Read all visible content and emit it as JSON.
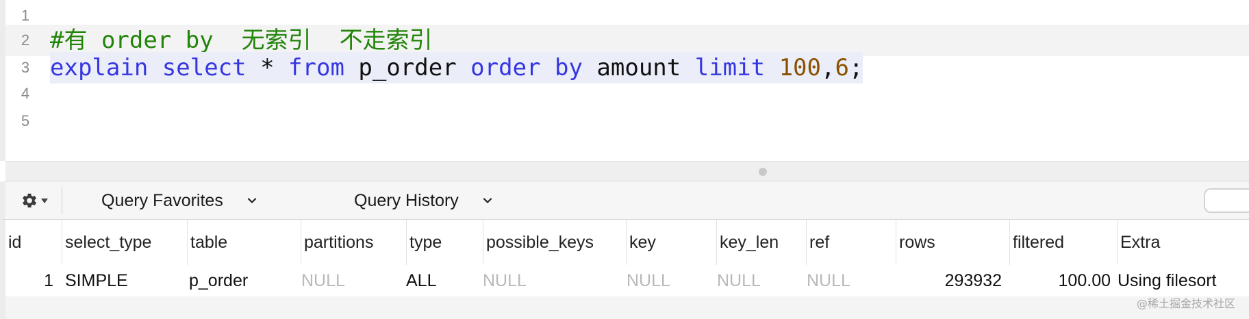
{
  "editor": {
    "lines": [
      {
        "number": "1"
      },
      {
        "number": "2",
        "comment": "#有 order by  无索引  不走索引"
      },
      {
        "number": "3",
        "tokens": [
          "explain",
          " ",
          "select",
          " * ",
          "from",
          " p_order ",
          "order",
          " ",
          "by",
          " amount ",
          "limit",
          " ",
          "100",
          ",",
          "6",
          ";"
        ]
      },
      {
        "number": "4"
      },
      {
        "number": "5"
      }
    ]
  },
  "toolbar": {
    "settings_icon": "gear-icon",
    "query_favorites_label": "Query Favorites",
    "query_history_label": "Query History"
  },
  "results": {
    "columns": [
      "id",
      "select_type",
      "table",
      "partitions",
      "type",
      "possible_keys",
      "key",
      "key_len",
      "ref",
      "rows",
      "filtered",
      "Extra"
    ],
    "rows": [
      [
        "1",
        "SIMPLE",
        "p_order",
        "NULL",
        "ALL",
        "NULL",
        "NULL",
        "NULL",
        "NULL",
        "293932",
        "100.00",
        "Using filesort"
      ]
    ]
  },
  "watermark": "@稀土掘金技术社区",
  "colors": {
    "keyword": "#3636e0",
    "number": "#8a5200",
    "comment": "#22850a",
    "null_text": "#b9b9b9",
    "line_highlight": "#f3f3f3",
    "selection": "#ebeef9"
  }
}
